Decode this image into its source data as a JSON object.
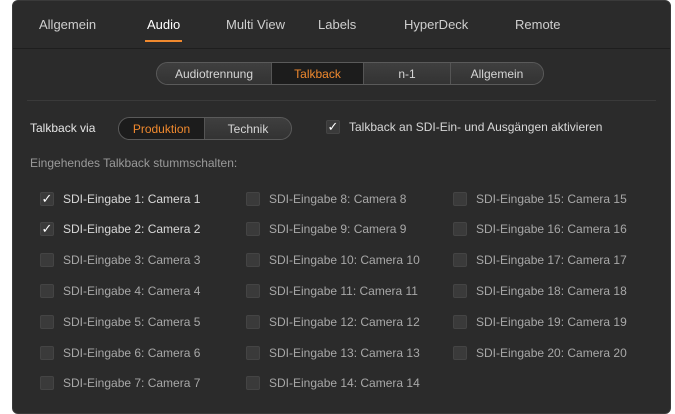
{
  "tabs": [
    {
      "label": "Allgemein",
      "active": false
    },
    {
      "label": "Audio",
      "active": true
    },
    {
      "label": "Multi View",
      "active": false
    },
    {
      "label": "Labels",
      "active": false
    },
    {
      "label": "HyperDeck",
      "active": false
    },
    {
      "label": "Remote",
      "active": false
    }
  ],
  "subtabs": [
    {
      "label": "Audiotrennung",
      "active": false
    },
    {
      "label": "Talkback",
      "active": true
    },
    {
      "label": "n-1",
      "active": false
    },
    {
      "label": "Allgemein",
      "active": false
    }
  ],
  "talkback": {
    "via_label": "Talkback via",
    "options": [
      {
        "label": "Produktion",
        "active": true
      },
      {
        "label": "Technik",
        "active": false
      }
    ],
    "sdi_enable": {
      "label": "Talkback an SDI-Ein- und Ausgängen aktivieren",
      "checked": true
    }
  },
  "mute": {
    "heading": "Eingehendes Talkback stummschalten:",
    "inputs": [
      {
        "label": "SDI-Eingabe 1: Camera 1",
        "checked": true
      },
      {
        "label": "SDI-Eingabe 2: Camera 2",
        "checked": true
      },
      {
        "label": "SDI-Eingabe 3: Camera 3",
        "checked": false
      },
      {
        "label": "SDI-Eingabe 4: Camera 4",
        "checked": false
      },
      {
        "label": "SDI-Eingabe 5: Camera 5",
        "checked": false
      },
      {
        "label": "SDI-Eingabe 6: Camera 6",
        "checked": false
      },
      {
        "label": "SDI-Eingabe 7: Camera 7",
        "checked": false
      },
      {
        "label": "SDI-Eingabe 8: Camera 8",
        "checked": false
      },
      {
        "label": "SDI-Eingabe 9: Camera 9",
        "checked": false
      },
      {
        "label": "SDI-Eingabe 10: Camera 10",
        "checked": false
      },
      {
        "label": "SDI-Eingabe 11: Camera 11",
        "checked": false
      },
      {
        "label": "SDI-Eingabe 12: Camera 12",
        "checked": false
      },
      {
        "label": "SDI-Eingabe 13: Camera 13",
        "checked": false
      },
      {
        "label": "SDI-Eingabe 14: Camera 14",
        "checked": false
      },
      {
        "label": "SDI-Eingabe 15: Camera 15",
        "checked": false
      },
      {
        "label": "SDI-Eingabe 16: Camera 16",
        "checked": false
      },
      {
        "label": "SDI-Eingabe 17: Camera 17",
        "checked": false
      },
      {
        "label": "SDI-Eingabe 18: Camera 18",
        "checked": false
      },
      {
        "label": "SDI-Eingabe 19: Camera 19",
        "checked": false
      },
      {
        "label": "SDI-Eingabe 20: Camera 20",
        "checked": false
      }
    ]
  },
  "colors": {
    "accent": "#f0892e",
    "panel": "#2b2b2b"
  },
  "icons": {
    "check": "checkmark-icon"
  }
}
